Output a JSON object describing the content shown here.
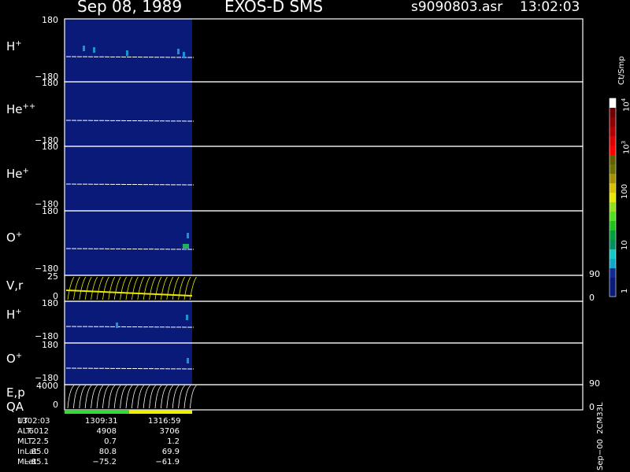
{
  "header": {
    "date": "Sep 08, 1989",
    "instrument": "EXOS-D SMS",
    "file": "s9090803.asr",
    "time": "13:02:03"
  },
  "colors": {
    "background": "#000000",
    "panel_fill": "#0a1a78",
    "trace": "#ffffff",
    "velocity_trace": "#e8e800",
    "qa_good": "#33dd33",
    "qa_warn": "#eeee00"
  },
  "colorbar": {
    "unit": "Ct/Smp",
    "tick_labels": [
      "1",
      "10",
      "100",
      "10",
      "10"
    ],
    "tick_exponents": [
      "",
      "",
      "",
      "3",
      "4"
    ],
    "colors": [
      "#0a1a78",
      "#0a1a78",
      "#10289a",
      "#10a8c8",
      "#12c8c8",
      "#009060",
      "#00a040",
      "#20c020",
      "#50e020",
      "#90e020",
      "#e8e800",
      "#d8c000",
      "#a89000",
      "#707000",
      "#606000",
      "#ff0000",
      "#e00000",
      "#b00000",
      "#900000",
      "#700000",
      "#ffffff"
    ]
  },
  "panels": [
    {
      "id": "h-plus",
      "species": "H",
      "charge": "+",
      "ymax": "180",
      "ymin": "−180"
    },
    {
      "id": "he-plus-plus",
      "species": "He",
      "charge": "++",
      "ymax": "180",
      "ymin": "−180"
    },
    {
      "id": "he-plus",
      "species": "He",
      "charge": "+",
      "ymax": "180",
      "ymin": "−180"
    },
    {
      "id": "o-plus",
      "species": "O",
      "charge": "+",
      "ymax": "180",
      "ymin": "−180"
    }
  ],
  "velocity_panel": {
    "label": "V,r",
    "ymax": "25",
    "ymin": "0",
    "right_max": "90",
    "right_min": "0"
  },
  "panels2": [
    {
      "id": "h-plus-2",
      "species": "H",
      "charge": "+",
      "ymax": "180",
      "ymin": "−180"
    },
    {
      "id": "o-plus-2",
      "species": "O",
      "charge": "+",
      "ymax": "180",
      "ymin": "−180"
    }
  ],
  "energy_panel": {
    "label": "E,p",
    "ymax": "4000",
    "ymin": "0",
    "right_max": "90",
    "right_min": "0"
  },
  "qa_label": "QA",
  "footer": {
    "row_labels": [
      "UT",
      "ALT",
      "MLT",
      "InLat",
      "MLat"
    ],
    "columns": [
      [
        "1302:03",
        "6012",
        "22.5",
        "85.0",
        "−85.1"
      ],
      [
        "1309:31",
        "4908",
        "0.7",
        "80.8",
        "−75.2"
      ],
      [
        "1316:59",
        "3706",
        "1.2",
        "69.9",
        "−61.9"
      ]
    ]
  },
  "side_note": "Sep−00  2CM33L",
  "chart_data": {
    "type": "heatmap",
    "title": "Sep 08, 1989   EXOS-D SMS",
    "x": [
      "1302:03",
      "1309:31",
      "1316:59"
    ],
    "y_range": [
      -180,
      180
    ],
    "series": [
      {
        "name": "H+",
        "ylim": [
          -180,
          180
        ]
      },
      {
        "name": "He++",
        "ylim": [
          -180,
          180
        ]
      },
      {
        "name": "He+",
        "ylim": [
          -180,
          180
        ]
      },
      {
        "name": "O+",
        "ylim": [
          -180,
          180
        ]
      },
      {
        "name": "V,r",
        "ylim": [
          0,
          25
        ]
      },
      {
        "name": "H+",
        "ylim": [
          -180,
          180
        ]
      },
      {
        "name": "O+",
        "ylim": [
          -180,
          180
        ]
      },
      {
        "name": "E,p",
        "ylim": [
          0,
          4000
        ]
      }
    ],
    "colorbar": {
      "label": "Ct/Smp",
      "scale": "log",
      "range": [
        1,
        10000
      ]
    }
  }
}
